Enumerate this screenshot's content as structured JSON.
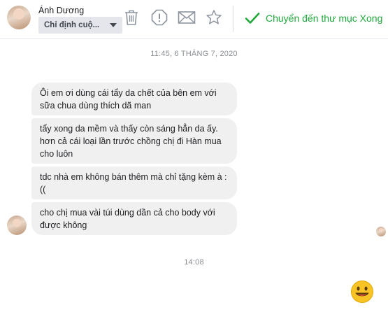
{
  "header": {
    "contact_name": "Ánh Dương",
    "assign_label": "Chỉ định cuộ...",
    "done_label": "Chuyển đến thư mục Xong"
  },
  "thread": {
    "timestamp_top": "11:45, 6 THÁNG 7, 2020",
    "messages": [
      {
        "text": "Ôi em ơi dùng cái tẩy da chết của bên em với sữa chua dùng thích dã man"
      },
      {
        "text": "tẩy xong da mềm và thấy còn sáng hẳn da ấy. hơn cả cái loại lần trước chồng chị đi Hàn mua cho luôn"
      },
      {
        "text": "tdc nhà em không bán thêm mà chỉ tặng kèm à :(("
      },
      {
        "text": "cho chị mua vài túi dùng dần cả cho body với được không"
      }
    ],
    "timestamp_bottom": "14:08"
  },
  "colors": {
    "done_green": "#1fa83a",
    "bubble_bg": "#f1f0f0",
    "icon_gray": "#8d949e"
  }
}
